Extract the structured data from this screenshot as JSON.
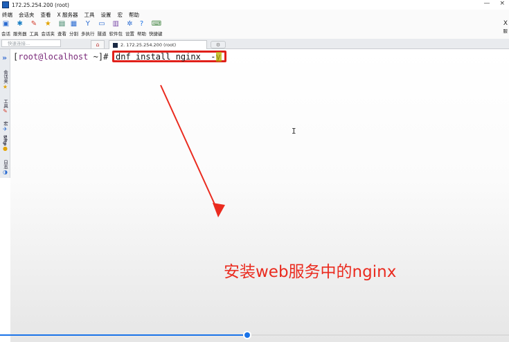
{
  "window": {
    "title": "172.25.254.200 (root)",
    "controls": [
      "—",
      "×"
    ]
  },
  "menu": [
    "终端",
    "会话夹",
    "查看",
    "X 服务器",
    "工具",
    "设置",
    "宏",
    "帮助"
  ],
  "toolbar": [
    {
      "label": "会话",
      "icon": "session-icon",
      "glyph": "▣",
      "color": "#2a6bd1"
    },
    {
      "label": "服务器",
      "icon": "servers-icon",
      "glyph": "✱",
      "color": "#1b7fc4"
    },
    {
      "label": "工具",
      "icon": "tools-icon",
      "glyph": "✎",
      "color": "#d33b2a"
    },
    {
      "label": "会话夹",
      "icon": "star-icon",
      "glyph": "★",
      "color": "#e3a300"
    },
    {
      "label": "查看",
      "icon": "view-icon",
      "glyph": "▤",
      "color": "#2c7a5a"
    },
    {
      "label": "分割",
      "icon": "split-icon",
      "glyph": "▦",
      "color": "#2a6bd1"
    },
    {
      "label": "多执行",
      "icon": "multiexec-icon",
      "glyph": "Y",
      "color": "#2a6bd1"
    },
    {
      "label": "隧道",
      "icon": "tunnel-icon",
      "glyph": "▭",
      "color": "#2a6bd1"
    },
    {
      "label": "软件包",
      "icon": "packages-icon",
      "glyph": "▥",
      "color": "#7a4aa8"
    },
    {
      "label": "设置",
      "icon": "settings-icon",
      "glyph": "✲",
      "color": "#2a6bd1"
    },
    {
      "label": "帮助",
      "icon": "help-icon",
      "glyph": "?",
      "color": "#1a73e8"
    },
    {
      "label": "快捷键",
      "icon": "shortcut-icon",
      "glyph": "⌨",
      "color": "#4a8a4a"
    }
  ],
  "toolbar_right": {
    "label": "X",
    "sublabel": "服"
  },
  "tabs": {
    "quick_connect_placeholder": "快速连接...",
    "home_glyph": "⌂",
    "session_label": "2. 172.25.254.200 (root)",
    "new_tab_glyph": "⚙"
  },
  "sidebar": [
    {
      "label": "会话夹",
      "icon": "star-icon",
      "glyph": "★"
    },
    {
      "label": "工具",
      "icon": "tools-icon",
      "glyph": "✎"
    },
    {
      "label": "宏",
      "icon": "macro-icon",
      "glyph": "✈"
    },
    {
      "label": "Sftp",
      "icon": "sftp-icon",
      "glyph": "●"
    },
    {
      "label": "日志",
      "icon": "log-icon",
      "glyph": "◑"
    }
  ],
  "sidebar_expand_glyph": "»",
  "terminal": {
    "prompt": "[root@localhost ~]#",
    "prompt_user": "root@localhost",
    "command": "dnf install nginx  -y"
  },
  "annotation": {
    "text": "安装web服务中的nginx"
  },
  "video": {
    "progress": 0.486
  },
  "colors": {
    "annotation": "#ea2b1f",
    "accent": "#1a73e8"
  }
}
